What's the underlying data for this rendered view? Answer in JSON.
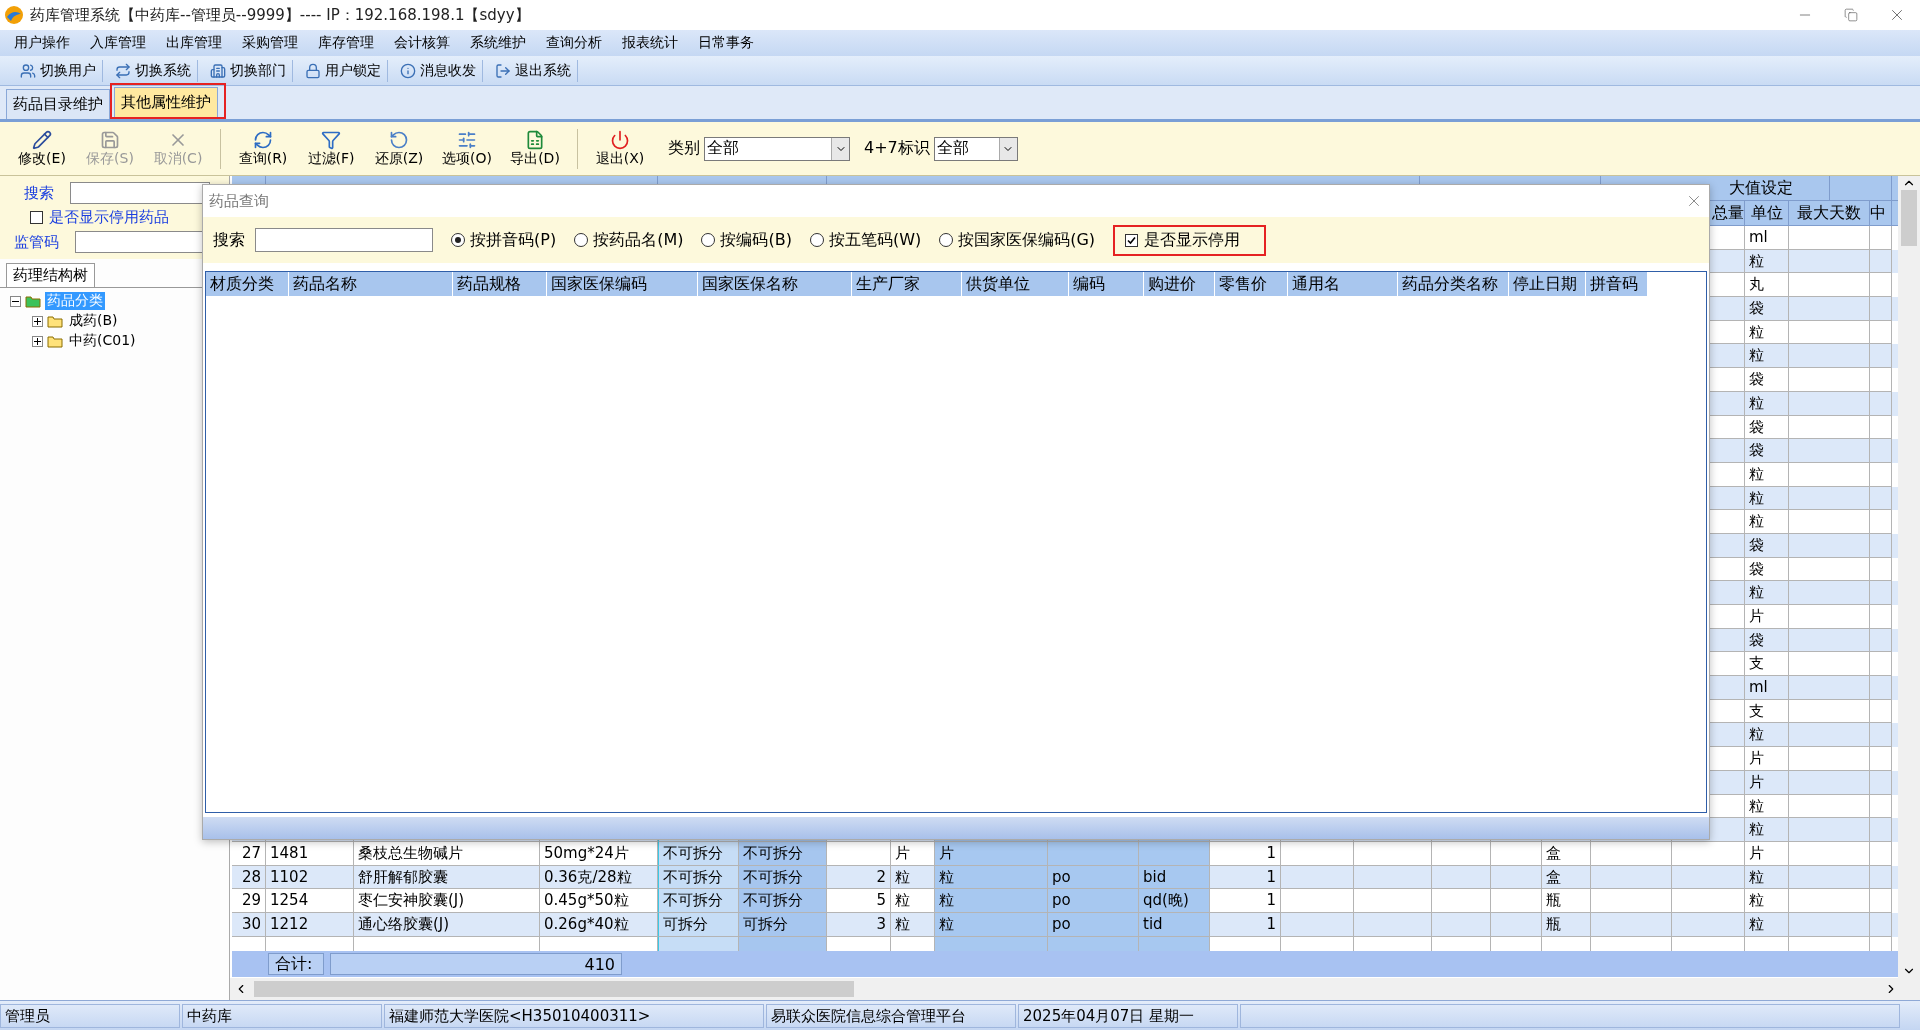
{
  "window": {
    "title": "药库管理系统【中药库--管理员--9999】---- IP：192.168.198.1【sdyy】"
  },
  "menu": [
    "用户操作",
    "入库管理",
    "出库管理",
    "采购管理",
    "库存管理",
    "会计核算",
    "系统维护",
    "查询分析",
    "报表统计",
    "日常事务"
  ],
  "quick_toolbar": [
    "切换用户",
    "切换系统",
    "切换部门",
    "用户锁定",
    "消息收发",
    "退出系统"
  ],
  "tabs": [
    {
      "label": "药品目录维护",
      "selected": false,
      "annotated": false
    },
    {
      "label": "其他属性维护",
      "selected": true,
      "annotated": true
    }
  ],
  "actions": [
    {
      "label": "修改(E)",
      "disabled": false
    },
    {
      "label": "保存(S)",
      "disabled": true
    },
    {
      "label": "取消(C)",
      "disabled": true
    },
    {
      "label": "查询(R)",
      "disabled": false
    },
    {
      "label": "过滤(F)",
      "disabled": false
    },
    {
      "label": "还原(Z)",
      "disabled": false
    },
    {
      "label": "选项(O)",
      "disabled": false
    },
    {
      "label": "导出(D)",
      "disabled": false
    },
    {
      "label": "退出(X)",
      "disabled": false
    }
  ],
  "filters": [
    {
      "label": "类别",
      "value": "全部"
    },
    {
      "label": "4+7标识",
      "value": "全部"
    }
  ],
  "left_panel": {
    "search_label": "搜索",
    "show_disabled": {
      "label": "是否显示停用药品",
      "checked": false
    },
    "code_label": "监管码",
    "tree_tab": "药理结构树",
    "tree": [
      {
        "label": "药品分类",
        "expanded": true,
        "selected": true,
        "children": [
          {
            "label": "成药(B)",
            "expanded": false,
            "selected": false
          },
          {
            "label": "中药(C01)",
            "expanded": false,
            "selected": false
          }
        ]
      }
    ]
  },
  "grid": {
    "group_header": "大值设定",
    "tail_headers": [
      "总量",
      "单位",
      "最大天数",
      "中"
    ],
    "rows": [
      {
        "unit": "ml"
      },
      {
        "unit": "粒"
      },
      {
        "unit": "丸"
      },
      {
        "unit": "袋"
      },
      {
        "unit": "粒"
      },
      {
        "unit": "粒"
      },
      {
        "unit": "袋"
      },
      {
        "unit": "粒"
      },
      {
        "unit": "袋"
      },
      {
        "unit": "袋"
      },
      {
        "unit": "粒"
      },
      {
        "unit": "粒"
      },
      {
        "unit": "粒"
      },
      {
        "unit": "袋"
      },
      {
        "unit": "袋"
      },
      {
        "unit": "粒"
      },
      {
        "unit": "片"
      },
      {
        "unit": "袋"
      },
      {
        "unit": "支"
      },
      {
        "unit": "ml"
      },
      {
        "unit": "支"
      },
      {
        "unit": "粒"
      },
      {
        "unit": "片"
      },
      {
        "unit": "片"
      },
      {
        "unit": "粒"
      },
      {
        "unit": "粒"
      },
      {
        "no": "27",
        "code": "1481",
        "name": "桑枝总生物碱片",
        "spec": "50mg*24片",
        "split_out": "不可拆分",
        "split_in": "不可拆分",
        "qty_unit": "片",
        "unit2": "片",
        "dose": "1",
        "pack_unit": "盒",
        "unit": "片"
      },
      {
        "no": "28",
        "code": "1102",
        "name": "舒肝解郁胶囊",
        "spec": "0.36克/28粒",
        "split_out": "不可拆分",
        "split_in": "不可拆分",
        "qty": "2",
        "qty_unit": "粒",
        "unit2": "粒",
        "route": "po",
        "freq": "bid",
        "dose": "1",
        "pack_unit": "盒",
        "unit": "粒"
      },
      {
        "no": "29",
        "code": "1254",
        "name": "枣仁安神胶囊(J)",
        "spec": "0.45g*50粒",
        "split_out": "不可拆分",
        "split_in": "不可拆分",
        "qty": "5",
        "qty_unit": "粒",
        "unit2": "粒",
        "route": "po",
        "freq": "qd(晚)",
        "dose": "1",
        "pack_unit": "瓶",
        "unit": "粒"
      },
      {
        "no": "30",
        "code": "1212",
        "name": "通心络胶囊(J)",
        "spec": "0.26g*40粒",
        "split_out": "可拆分",
        "split_in": "可拆分",
        "qty": "3",
        "qty_unit": "粒",
        "unit2": "粒",
        "route": "po",
        "freq": "tid",
        "dose": "1",
        "pack_unit": "瓶",
        "unit": "粒"
      },
      {}
    ],
    "total_label": "合计:",
    "total": "410"
  },
  "dialog": {
    "title": "药品查询",
    "search_label": "搜索",
    "modes": [
      {
        "label": "按拼音码(P)",
        "selected": true
      },
      {
        "label": "按药品名(M)",
        "selected": false
      },
      {
        "label": "按编码(B)",
        "selected": false
      },
      {
        "label": "按五笔码(W)",
        "selected": false
      },
      {
        "label": "按国家医保编码(G)",
        "selected": false
      }
    ],
    "show_disabled": {
      "label": "是否显示停用",
      "checked": true,
      "annotated": true
    },
    "columns": [
      "材质分类",
      "药品名称",
      "药品规格",
      "国家医保编码",
      "国家医保名称",
      "生产厂家",
      "供货单位",
      "编码",
      "购进价",
      "零售价",
      "通用名",
      "药品分类名称",
      "停止日期",
      "拼音码"
    ]
  },
  "status_bar": [
    "管理员",
    "中药库",
    "福建师范大学医院<H35010400311>",
    "易联众医院信息综合管理平台",
    "2025年04月07日 星期一"
  ]
}
